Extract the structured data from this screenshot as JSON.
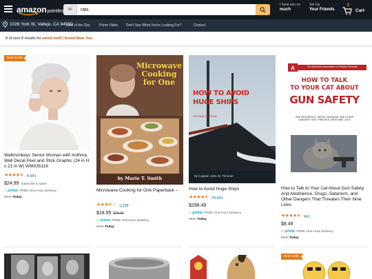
{
  "header": {
    "logo_text": "amazon",
    "logo_sub": "pointless",
    "search_department": "All",
    "search_query": "rats",
    "account_line1": "I have you so",
    "account_line2": "much",
    "setup_line1": "Set Up",
    "setup_line2": "Your Friends",
    "cart_count": "0",
    "cart_label": "Cart"
  },
  "subnav": {
    "location": "1026 York St, Vallejo, CA 94590",
    "links": [
      "Deal of the Day",
      "Prime Video",
      "Don't See What You're Looking For?",
      "Contact"
    ]
  },
  "results": {
    "prefix": "8 of over 8 results for ",
    "query": "weird stuff I found Near You"
  },
  "products": [
    {
      "badge": "Best Seller",
      "title": "Wallmonkeys Senior Woman with Asthma Wall Decal Peel and Stick Graphic (24 in H x 21 in W) WM335116",
      "rating_stars": 4.5,
      "rating_count": "4,941",
      "price": "$24.99",
      "price_note": "Subscribe & Save!",
      "prime_label": "prime",
      "delivery": "FREE One-Hour Delivery",
      "ship_prefix": "Meet ",
      "ship_day": "Today"
    },
    {
      "image_title": "Microwave Cooking for One",
      "image_author": "by Marie T. Smith",
      "title": "Microwave Cooking for One Paperback –",
      "rating_stars": 3.5,
      "rating_count": "1,338",
      "price": "$18.95",
      "list_price": "$25.99",
      "prime_label": "prime",
      "delivery": "FREE One-Hour Delivery",
      "ship_prefix": "Meet ",
      "ship_day": "Today"
    },
    {
      "image_title_line1": "HOW TO AVOID",
      "image_title_line2": "HUGE SHIPS",
      "image_edition": "SECOND EDITION",
      "image_author": "by Captain John W. Trimmer",
      "title": "How to Avoid Huge Ships",
      "rating_stars": 4.5,
      "rating_count": "78,941",
      "price": "$298.49",
      "prime_label": "prime",
      "delivery": "FREE One-Hour Delivery",
      "ship_prefix": "Meet ",
      "ship_day": "Today"
    },
    {
      "image_assoc": "The American Association of Patriots Presents",
      "image_title_line1": "HOW TO TALK",
      "image_title_line2": "TO YOUR CAT ABOUT",
      "image_title_line3": "GUN SAFETY",
      "image_subtitle": "AND ABSTINENCE, DRUGS, SATANISM, AND OTHER DANGERS THAT THREATEN THEIR NINE LIVES",
      "title": "How to Talk to Your Cat About Gun Safety: And Abstinence, Drugs, Satanism, and Other Dangers That Threaten Their Nine Lives",
      "rating_stars": 4.5,
      "rating_count": "941",
      "price": "$8.49",
      "prime_label": "prime",
      "delivery": "FREE One-Hour Delivery",
      "ship_prefix": "Meet ",
      "ship_day": "Today"
    }
  ],
  "row2_badge": "Best Seller",
  "colors": {
    "nav_dark": "#131921",
    "nav_sub": "#232f3e",
    "search_button": "#febd69",
    "badge": "#e47911",
    "star": "#de7921",
    "link": "#007185",
    "prime": "#00a8e1"
  }
}
